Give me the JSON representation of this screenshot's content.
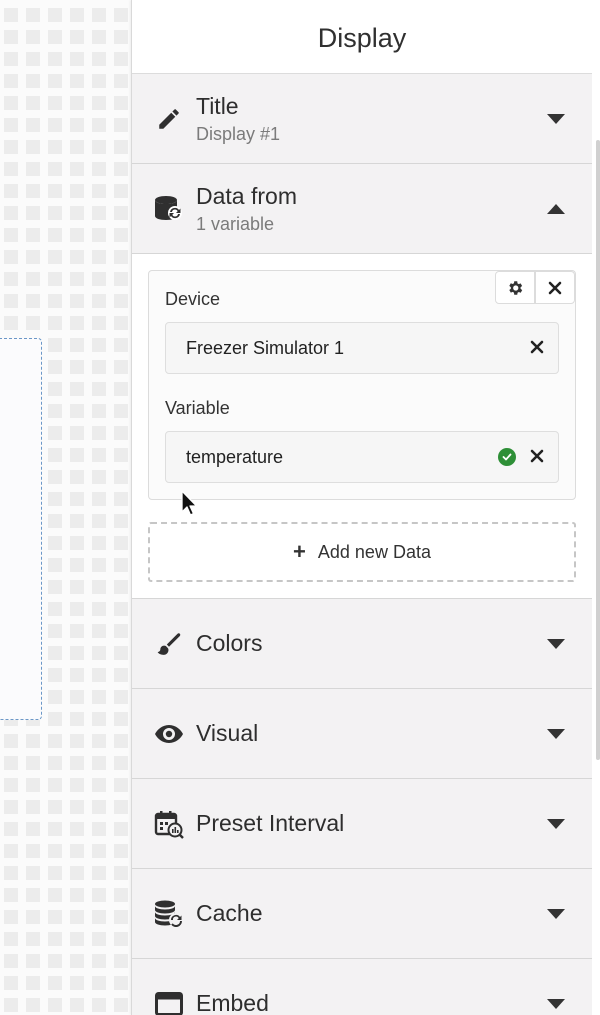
{
  "panel": {
    "title": "Display",
    "sections": {
      "title": {
        "label": "Title",
        "sub": "Display #1",
        "icon": "pencil-icon"
      },
      "data_from": {
        "label": "Data from",
        "sub": "1 variable",
        "icon": "database-sync-icon"
      },
      "colors": {
        "label": "Colors",
        "icon": "brush-icon"
      },
      "visual": {
        "label": "Visual",
        "icon": "eye-icon"
      },
      "preset_interval": {
        "label": "Preset Interval",
        "icon": "calendar-chart-icon"
      },
      "cache": {
        "label": "Cache",
        "icon": "database-refresh-icon"
      },
      "embed": {
        "label": "Embed",
        "icon": "window-icon"
      }
    }
  },
  "data_card": {
    "device_label": "Device",
    "device_value": "Freezer Simulator 1",
    "variable_label": "Variable",
    "variable_value": "temperature",
    "add_label": "Add new Data"
  },
  "colors": {
    "accent_check": "#2e8f37",
    "panel_bg": "#f3f2f3",
    "widget_border": "#6b97c7"
  }
}
